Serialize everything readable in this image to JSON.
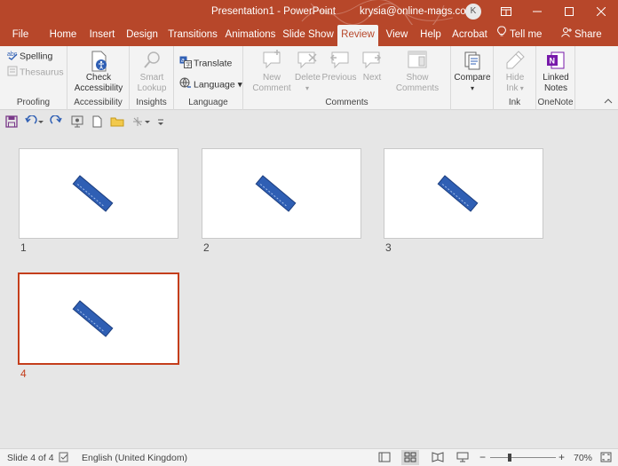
{
  "titlebar": {
    "title": "Presentation1  -  PowerPoint",
    "account": "krysia@online-mags.com",
    "avatar_initial": "K",
    "restore_icon": "ribbon-display-icon",
    "minimize_icon": "minimize-icon",
    "maximize_icon": "maximize-icon",
    "close_icon": "close-icon"
  },
  "tabs": [
    {
      "label": "File"
    },
    {
      "label": "Home"
    },
    {
      "label": "Insert"
    },
    {
      "label": "Design"
    },
    {
      "label": "Transitions"
    },
    {
      "label": "Animations"
    },
    {
      "label": "Slide Show"
    },
    {
      "label": "Review"
    },
    {
      "label": "View"
    },
    {
      "label": "Help"
    },
    {
      "label": "Acrobat"
    }
  ],
  "tellme": "Tell me",
  "share": "Share",
  "ribbon": {
    "proofing": {
      "label": "Proofing",
      "spelling": "Spelling",
      "thesaurus": "Thesaurus"
    },
    "accessibility": {
      "label": "Accessibility",
      "check_line1": "Check",
      "check_line2": "Accessibility"
    },
    "insights": {
      "label": "Insights",
      "smart_line1": "Smart",
      "smart_line2": "Lookup"
    },
    "language": {
      "label": "Language",
      "translate": "Translate",
      "language": "Language"
    },
    "comments": {
      "label": "Comments",
      "new_line1": "New",
      "new_line2": "Comment",
      "delete": "Delete",
      "previous": "Previous",
      "next": "Next",
      "show_line1": "Show",
      "show_line2": "Comments"
    },
    "compare": {
      "label": "Compare"
    },
    "ink": {
      "label": "Ink",
      "hide_line1": "Hide",
      "hide_line2": "Ink"
    },
    "onenote": {
      "label": "OneNote",
      "linked_line1": "Linked",
      "linked_line2": "Notes"
    }
  },
  "slides": [
    {
      "number": "1"
    },
    {
      "number": "2"
    },
    {
      "number": "3"
    },
    {
      "number": "4"
    }
  ],
  "statusbar": {
    "slide_info": "Slide 4 of 4",
    "language": "English (United Kingdom)",
    "zoom_minus": "−",
    "zoom_plus": "+",
    "zoom_level": "70%"
  },
  "colors": {
    "accent": "#b7472a",
    "selected_border": "#c43e1c",
    "shape_blue": "#2f5fb4"
  }
}
